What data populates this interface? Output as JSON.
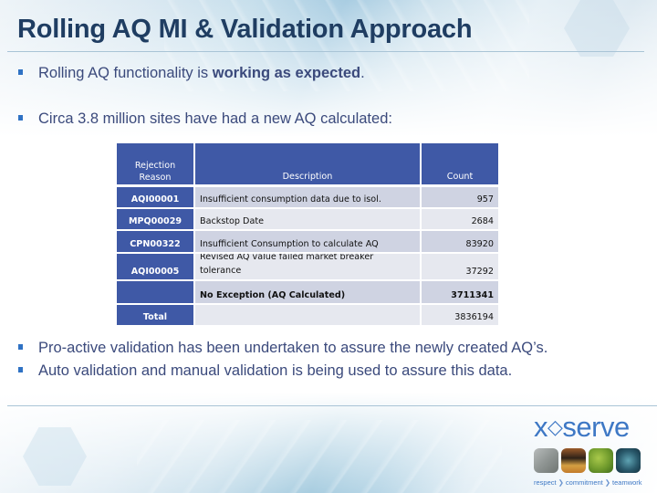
{
  "slide": {
    "title": "Rolling AQ MI & Validation Approach",
    "bullets": [
      {
        "text_before": "Rolling AQ functionality is ",
        "text_bold": "working as expected",
        "text_after": "."
      },
      {
        "text": "Circa 3.8 million sites have had a new AQ calculated:"
      },
      {
        "text": "Pro-active validation has been undertaken to assure the newly created AQ’s."
      },
      {
        "text": "Auto validation and manual validation is being used to assure this data."
      }
    ],
    "bullet_icon": "square-bullet-icon"
  },
  "table": {
    "headers": {
      "reason": "Rejection Reason",
      "reason_line1": "Rejection",
      "reason_line2": "Reason",
      "description": "Description",
      "count": "Count"
    },
    "rows": [
      {
        "reason": "AQI00001",
        "description": "Insufficient consumption data due to isol.",
        "count": "957",
        "bold": false
      },
      {
        "reason": "MPQ00029",
        "description": "Backstop Date",
        "count": "2684",
        "bold": false
      },
      {
        "reason": "CPN00322",
        "description": "Insufficient Consumption to calculate AQ",
        "count": "83920",
        "bold": false
      },
      {
        "reason": "AQI00005",
        "description": "Revised AQ value failed market breaker tolerance",
        "description_line1": "Revised AQ value failed market breaker",
        "description_line2": "tolerance",
        "count": "37292",
        "bold": false
      },
      {
        "reason": "",
        "description": "No Exception (AQ Calculated)",
        "count": "3711341",
        "bold": true
      },
      {
        "reason": "Total",
        "description": "",
        "count": "3836194",
        "bold": false
      }
    ],
    "colors": {
      "header_bg": "#3f59a6",
      "row_dark": "#cfd3e2",
      "row_light": "#e6e8ef"
    }
  },
  "logo": {
    "brand": "xoserve",
    "brand_prefix": "x",
    "brand_mark": "◇",
    "brand_suffix": "serve",
    "tagline": [
      "respect",
      "commitment",
      "teamwork"
    ],
    "tagline_separator": "❯",
    "brand_color": "#3e78c5"
  }
}
